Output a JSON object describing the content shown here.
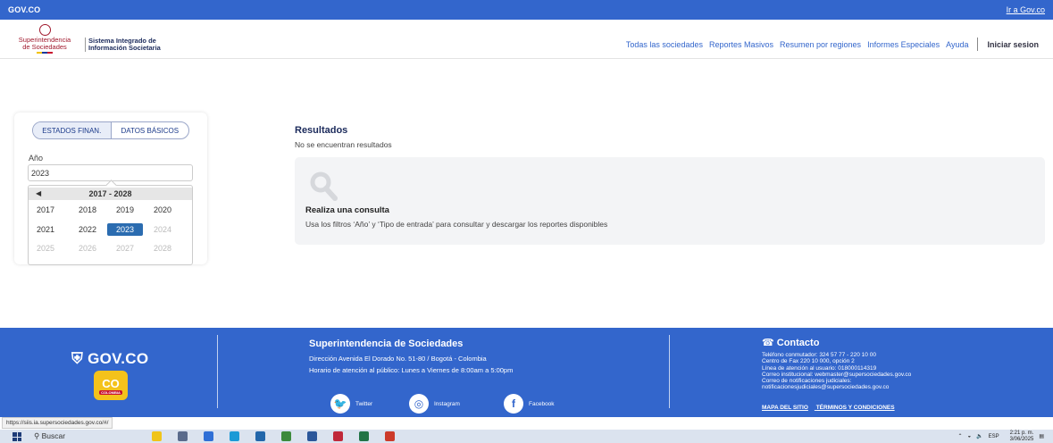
{
  "topbar": {
    "gov": "GOV.CO",
    "link": "Ir a Gov.co"
  },
  "header": {
    "logo_line1": "Superintendencia",
    "logo_line2": "de Sociedades",
    "system_line1": "Sistema Integrado de",
    "system_line2": "Información Societaria",
    "nav": [
      "Todas las sociedades",
      "Reportes Masivos",
      "Resumen por regiones",
      "Informes Especiales",
      "Ayuda"
    ],
    "login": "Iniciar sesion"
  },
  "filters": {
    "tab_financial": "ESTADOS FINAN.",
    "tab_basic": "DATOS BÁSICOS",
    "year_label": "Año",
    "year_value": "2023",
    "picker_range": "2017 - 2028",
    "years_row1": [
      "2017",
      "2018",
      "2019",
      "2020"
    ],
    "years_row2": [
      "2021",
      "2022",
      "2023",
      "2024"
    ],
    "years_row3": [
      "2025",
      "2026",
      "2027",
      "2028"
    ],
    "selected_year": "2023"
  },
  "results": {
    "title": "Resultados",
    "subtitle": "No se encuentran resultados",
    "card_title": "Realiza una consulta",
    "card_desc": "Usa los filtros ‘Año’ y ‘Tipo de entrada’ para consultar y descargar los reportes disponibles"
  },
  "footer": {
    "gov": "GOV.CO",
    "co_badge": "CO",
    "co_sub": "COLOMBIA",
    "org": "Superintendencia de Sociedades",
    "address": "Dirección Avenida El Dorado No. 51-80 / Bogotá - Colombia",
    "hours": "Horario de atención al público: Lunes a Viernes de 8:00am a 5:00pm",
    "social": [
      "Twitter",
      "Instagram",
      "Facebook"
    ],
    "contact_title": "Contacto",
    "contact_lines": [
      "Teléfono conmutador: 324 57 77 - 220 10 00",
      "Centro de Fax 220 10 000, opción 2",
      "Línea de atención al usuario: 018000114319",
      "Correo institucional: webmaster@supersociedades.gov.co",
      "Correo de notificaciones judiciales:",
      "notificacionesjudiciales@supersociedades.gov.co"
    ],
    "links": [
      "MAPA DEL SITIO",
      "TÉRMINOS Y CONDICIONES"
    ]
  },
  "status_url": "https://siis.ia.supersociedades.gov.co/#/",
  "taskbar": {
    "search": "Buscar",
    "lang": "ESP",
    "time": "2:21 p. m.",
    "date": "3/06/2025"
  },
  "colors": {
    "brand_blue": "#3366cc",
    "selected": "#2b6cb0"
  }
}
